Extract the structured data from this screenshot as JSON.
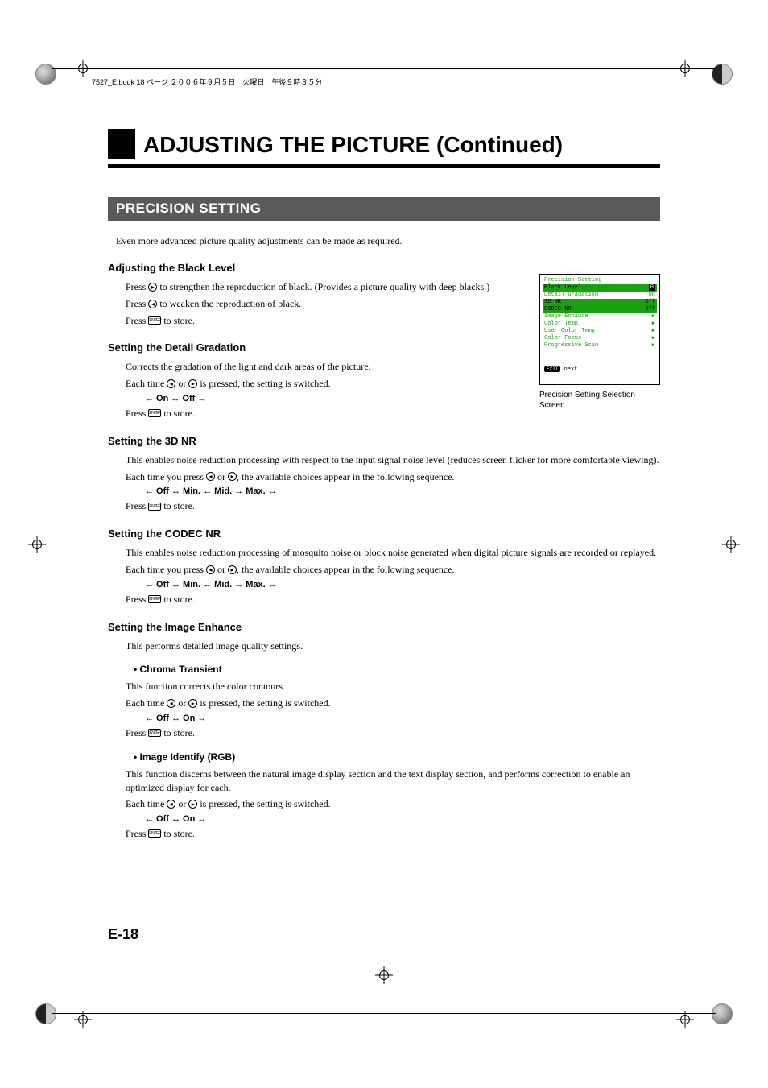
{
  "header_strip": "7527_E.book  18 ページ  ２００６年９月５日　火曜日　午後９時３５分",
  "title": "ADJUSTING THE PICTURE (Continued)",
  "section": "PRECISION SETTING",
  "intro": "Even more advanced picture quality adjustments can be made as required.",
  "black_level": {
    "h": "Adjusting the Black Level",
    "p1a": "Press ",
    "p1b": " to strengthen the reproduction of black. (Provides a picture quality with deep blacks.)",
    "p2a": "Press ",
    "p2b": " to weaken the reproduction of black.",
    "p3a": "Press ",
    "p3b": " to store."
  },
  "detail_grad": {
    "h": "Setting the Detail Gradation",
    "p1": "Corrects the gradation of the light and dark areas of the picture.",
    "p2a": "Each time ",
    "p2b": " or ",
    "p2c": " is pressed, the setting is switched.",
    "seq": "↔ On ↔ Off ↔",
    "p3a": "Press ",
    "p3b": " to store."
  },
  "nr3d": {
    "h": "Setting the 3D NR",
    "p1": "This enables noise reduction processing with respect to the input signal noise level (reduces screen flicker for more comfortable viewing).",
    "p2a": "Each time you press ",
    "p2b": " or ",
    "p2c": ", the available choices appear in the following sequence.",
    "seq": "↔ Off ↔ Min. ↔ Mid. ↔ Max. ↔",
    "p3a": "Press ",
    "p3b": " to store."
  },
  "codec": {
    "h": "Setting the CODEC NR",
    "p1": "This enables noise reduction processing of mosquito noise or block noise generated when digital picture signals are recorded or replayed.",
    "p2a": "Each time you press ",
    "p2b": " or ",
    "p2c": ", the available choices appear in the following sequence.",
    "seq": "↔ Off ↔ Min. ↔ Mid. ↔ Max. ↔",
    "p3a": "Press ",
    "p3b": " to store."
  },
  "img_enh": {
    "h": "Setting the Image Enhance",
    "p1": "This performs detailed image quality settings.",
    "chroma_h": "Chroma Transient",
    "chroma_p1": "This function corrects the color contours.",
    "each_a": "Each time ",
    "each_b": " or ",
    "each_c": " is pressed, the setting is switched.",
    "seq_offon": "↔ Off ↔ On ↔",
    "p3a": "Press ",
    "p3b": " to store.",
    "ident_h": " Image Identify (RGB)",
    "ident_p1": "This function discerns between the natural image display section and the text display section, and performs correction to enable an optimized display for each."
  },
  "osd": {
    "title": "Precision Setting",
    "rows": [
      {
        "l": "Black Level",
        "sel": true,
        "v": "0"
      },
      {
        "l": "Detail Gradation",
        "v": "On"
      },
      {
        "l": "3D NR",
        "sel": true,
        "v": "Off"
      },
      {
        "l": "CODEC NR",
        "sel": true,
        "v": "Off"
      },
      {
        "l": "Image Enhance",
        "arrow": true
      },
      {
        "l": "Color Temp.",
        "arrow": true
      },
      {
        "l": "User Color Temp.",
        "arrow": true
      },
      {
        "l": "Color Focus",
        "arrow": true
      },
      {
        "l": "Progressive Scan",
        "arrow": true
      }
    ],
    "foot_key": "EXIT",
    "foot_txt": " next",
    "caption": "Precision Setting Selection Screen"
  },
  "page_no": "E-18",
  "icons": {
    "right": "▸",
    "left": "◂",
    "enter": "ENTER"
  }
}
